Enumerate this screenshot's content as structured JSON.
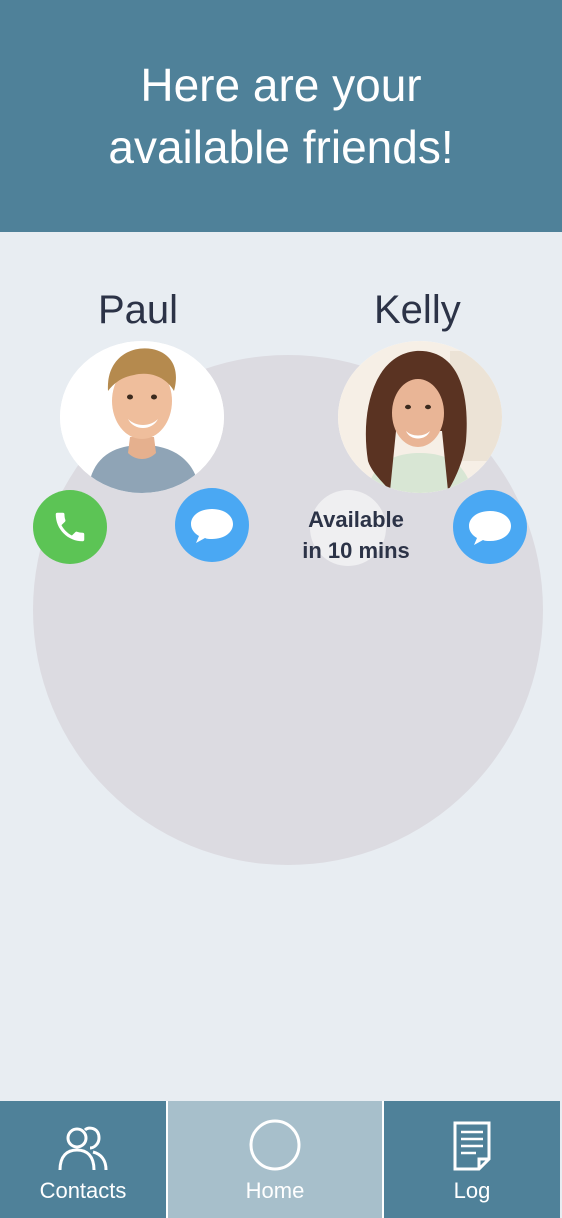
{
  "header": {
    "title": "Here are your available friends!"
  },
  "friends": [
    {
      "name": "Paul",
      "status": ""
    },
    {
      "name": "Kelly",
      "status": "Available\nin 10 mins"
    }
  ],
  "nav": {
    "items": [
      {
        "label": "Contacts",
        "icon": "contacts-icon"
      },
      {
        "label": "Home",
        "icon": "home-circle-icon",
        "active": true
      },
      {
        "label": "Log",
        "icon": "log-document-icon"
      }
    ]
  },
  "colors": {
    "header": "#4f8199",
    "background": "#e8edf2",
    "circle": "#dcdbe1",
    "call": "#5cc455",
    "message": "#4aa8f3",
    "nav_active": "#a7bfcb"
  }
}
